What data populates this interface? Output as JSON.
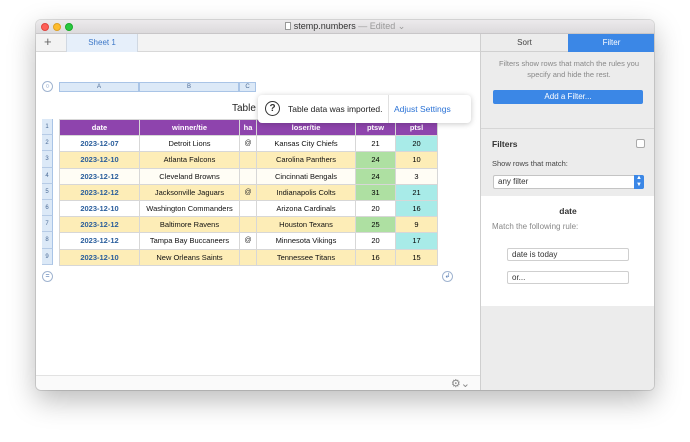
{
  "window": {
    "title": "stemp.numbers",
    "edited": "— Edited ⌄"
  },
  "toolbar": {
    "add_sheet": "+",
    "sheet_tab": "Sheet 1"
  },
  "notice": {
    "icon": "question-icon",
    "text": "Table data was imported.",
    "action": "Adjust Settings"
  },
  "table": {
    "title": "Table 1",
    "column_refs": [
      "A",
      "B",
      "C"
    ],
    "row_numbers": [
      "1",
      "2",
      "3",
      "4",
      "5",
      "6",
      "7",
      "8",
      "9"
    ],
    "headers": [
      "date",
      "winner/tie",
      "ha",
      "loser/tie",
      "ptsw",
      "ptsl"
    ],
    "rows": [
      {
        "date": "2023-12-07",
        "winner": "Detroit Lions",
        "ha": "@",
        "loser": "Kansas City Chiefs",
        "ptsw": "21",
        "ptsl": "20",
        "row_bg": "bg-white",
        "ptsw_bg": "bg-white",
        "ptsl_bg": "bg-teal"
      },
      {
        "date": "2023-12-10",
        "winner": "Atlanta Falcons",
        "ha": "",
        "loser": "Carolina Panthers",
        "ptsw": "24",
        "ptsl": "10",
        "row_bg": "bg-yellow",
        "ptsw_bg": "bg-green",
        "ptsl_bg": "bg-yellow"
      },
      {
        "date": "2023-12-12",
        "winner": "Cleveland Browns",
        "ha": "",
        "loser": "Cincinnati Bengals",
        "ptsw": "24",
        "ptsl": "3",
        "row_bg": "bg-pale",
        "ptsw_bg": "bg-green",
        "ptsl_bg": "bg-pale"
      },
      {
        "date": "2023-12-12",
        "winner": "Jacksonville Jaguars",
        "ha": "@",
        "loser": "Indianapolis Colts",
        "ptsw": "31",
        "ptsl": "21",
        "row_bg": "bg-yellow",
        "ptsw_bg": "bg-green",
        "ptsl_bg": "bg-teal"
      },
      {
        "date": "2023-12-10",
        "winner": "Washington Commanders",
        "ha": "",
        "loser": "Arizona Cardinals",
        "ptsw": "20",
        "ptsl": "16",
        "row_bg": "bg-white",
        "ptsw_bg": "bg-white",
        "ptsl_bg": "bg-teal"
      },
      {
        "date": "2023-12-12",
        "winner": "Baltimore Ravens",
        "ha": "",
        "loser": "Houston Texans",
        "ptsw": "25",
        "ptsl": "9",
        "row_bg": "bg-yellow",
        "ptsw_bg": "bg-green",
        "ptsl_bg": "bg-yellow"
      },
      {
        "date": "2023-12-12",
        "winner": "Tampa Bay Buccaneers",
        "ha": "@",
        "loser": "Minnesota Vikings",
        "ptsw": "20",
        "ptsl": "17",
        "row_bg": "bg-white",
        "ptsw_bg": "bg-white",
        "ptsl_bg": "bg-teal"
      },
      {
        "date": "2023-12-10",
        "winner": "New Orleans Saints",
        "ha": "",
        "loser": "Tennessee Titans",
        "ptsw": "16",
        "ptsl": "15",
        "row_bg": "bg-yellow",
        "ptsw_bg": "bg-yellow",
        "ptsl_bg": "bg-yellow"
      }
    ]
  },
  "sidebar": {
    "tabs": {
      "sort": "Sort",
      "filter": "Filter"
    },
    "hint": "Filters show rows that match the rules you specify and hide the rest.",
    "add_filter": "Add a Filter...",
    "filters_label": "Filters",
    "show_rows_label": "Show rows that match:",
    "show_rows_value": "any filter",
    "rule_column": "date",
    "match_rule_label": "Match the following rule:",
    "rule_1": "date is today",
    "rule_2": "or..."
  },
  "colors": {
    "accent": "#3b87e6",
    "header_purple": "#8e44ad",
    "highlight_green": "#aee0a2",
    "highlight_teal": "#a8ebe8",
    "highlight_yellow": "#fdedb7"
  },
  "statusbar": {
    "icon": "gear-icon"
  }
}
